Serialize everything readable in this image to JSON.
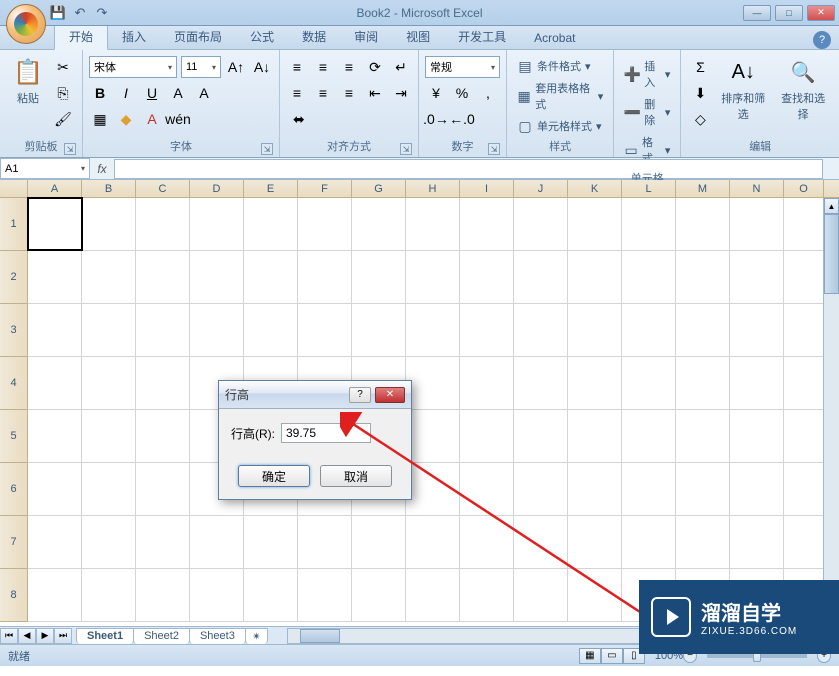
{
  "title": "Book2 - Microsoft Excel",
  "qat": {
    "save": "💾",
    "undo": "↶",
    "redo": "↷"
  },
  "tabs": [
    "开始",
    "插入",
    "页面布局",
    "公式",
    "数据",
    "审阅",
    "视图",
    "开发工具",
    "Acrobat"
  ],
  "active_tab": 0,
  "ribbon": {
    "clipboard": {
      "label": "剪贴板",
      "paste": "粘贴"
    },
    "font": {
      "label": "字体",
      "name": "宋体",
      "size": "11"
    },
    "alignment": {
      "label": "对齐方式"
    },
    "number": {
      "label": "数字",
      "format": "常规"
    },
    "styles": {
      "label": "样式",
      "cond_format": "条件格式",
      "table_format": "套用表格格式",
      "cell_styles": "单元格样式"
    },
    "cells": {
      "label": "单元格",
      "insert": "插入",
      "delete": "删除",
      "format": "格式"
    },
    "editing": {
      "label": "编辑",
      "sort_filter": "排序和筛选",
      "find_select": "查找和选择"
    }
  },
  "namebox": "A1",
  "columns": [
    "A",
    "B",
    "C",
    "D",
    "E",
    "F",
    "G",
    "H",
    "I",
    "J",
    "K",
    "L",
    "M",
    "N",
    "O"
  ],
  "rows": [
    "1",
    "2",
    "3",
    "4",
    "5",
    "6",
    "7",
    "8"
  ],
  "sheets": [
    "Sheet1",
    "Sheet2",
    "Sheet3"
  ],
  "active_sheet": 0,
  "status": "就绪",
  "zoom": "100%",
  "dialog": {
    "title": "行高",
    "label": "行高(R):",
    "value": "39.75",
    "ok": "确定",
    "cancel": "取消"
  },
  "watermark": {
    "big": "溜溜自学",
    "small": "ZIXUE.3D66.COM"
  }
}
